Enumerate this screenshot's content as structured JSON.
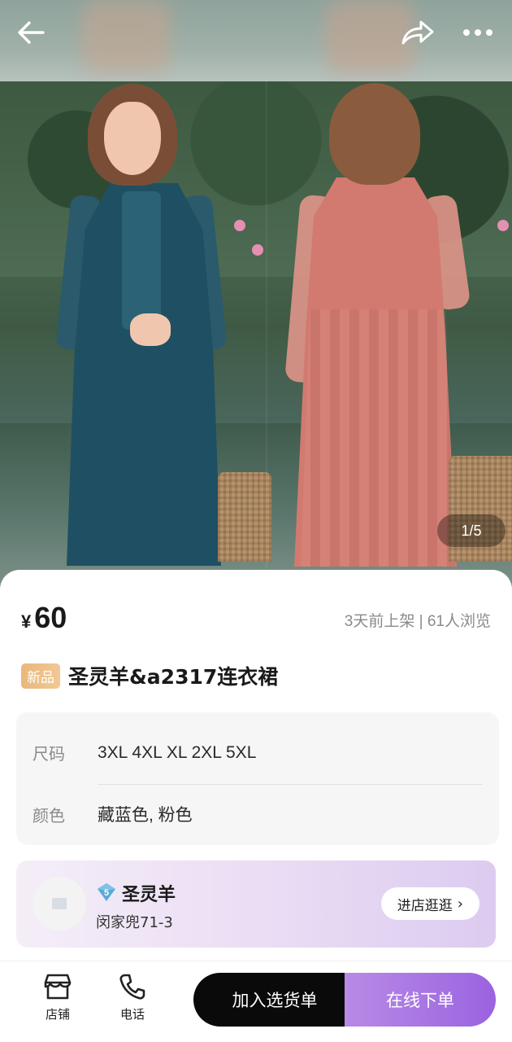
{
  "gallery": {
    "counter": "1/5"
  },
  "nav": {
    "back_icon": "arrow-left-icon",
    "share_icon": "share-icon",
    "more_icon": "more-icon"
  },
  "product": {
    "currency": "¥",
    "price": "60",
    "meta": "3天前上架 | 61人浏览",
    "badge": "新品",
    "title": "圣灵羊&a2317连衣裙"
  },
  "specs": [
    {
      "label": "尺码",
      "value": "3XL 4XL XL 2XL 5XL"
    },
    {
      "label": "颜色",
      "value": "藏蓝色, 粉色"
    }
  ],
  "shop": {
    "level": "5",
    "name": "圣灵羊",
    "address": "闵家兜71-3",
    "enter_label": "进店逛逛",
    "enter_chevron": "›"
  },
  "bottom": {
    "store_label": "店铺",
    "phone_label": "电话",
    "add_cart_label": "加入选货单",
    "order_label": "在线下单"
  },
  "colors": {
    "accent_purple": "#9b63e0",
    "badge_gold": "#e9b77c",
    "dark_button": "#0a0a0a"
  }
}
